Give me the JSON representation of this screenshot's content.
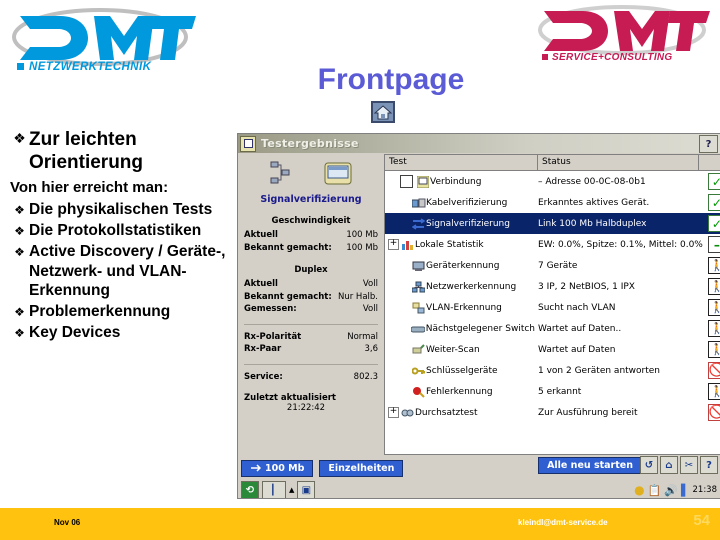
{
  "slide": {
    "title": "Frontpage",
    "home_icon": "home-icon",
    "page_number": "54"
  },
  "logo_left": {
    "word": "DMT",
    "tagline": "NETZWERKTECHNIK",
    "color": "#0099dd"
  },
  "logo_right": {
    "word": "DMT",
    "tagline": "SERVICE+CONSULTING",
    "color": "#c71b54"
  },
  "bullets": [
    {
      "level": 1,
      "mark": "❖",
      "text": "Zur leichten Orientierung"
    }
  ],
  "lead_in": "Von hier erreicht man:",
  "sub_bullets": [
    {
      "mark": "❖",
      "text": "Die physikalischen Tests"
    },
    {
      "mark": "❖",
      "text": "Die Protokollstatistiken"
    },
    {
      "mark": "❖",
      "text": "Active Discovery / Geräte-, Netzwerk- und VLAN-Erkennung"
    },
    {
      "mark": "❖",
      "text": "Problemerkennung"
    },
    {
      "mark": "❖",
      "text": "Key Devices"
    }
  ],
  "app": {
    "title": "Testergebnisse",
    "help_button": "?",
    "left_pane": {
      "heading": "Signalverifizierung",
      "sections": [
        {
          "title": "Geschwindigkeit",
          "rows": [
            {
              "key": "Aktuell",
              "value": "100 Mb"
            },
            {
              "key": "Bekannt gemacht:",
              "value": "100 Mb"
            }
          ]
        },
        {
          "title": "Duplex",
          "rows": [
            {
              "key": "Aktuell",
              "value": "Voll"
            },
            {
              "key": "Bekannt gemacht:",
              "value": "Nur Halb."
            },
            {
              "key": "Gemessen:",
              "value": "Voll"
            }
          ]
        }
      ],
      "extra_rows": [
        {
          "key": "Rx-Polarität",
          "value": "Normal"
        },
        {
          "key": "Rx-Paar",
          "value": "3,6"
        }
      ],
      "service_row": {
        "key": "Service:",
        "value": "802.3"
      },
      "updated_label": "Zuletzt aktualisiert",
      "updated_time": "21:22:42"
    },
    "columns": {
      "test": "Test",
      "status": "Status",
      "icon": ""
    },
    "rows": [
      {
        "indent": 0,
        "expander": "",
        "checkbox": true,
        "icon": "monitor-icon",
        "test": "Verbindung",
        "status": "– Adresse 00-0C-08-0b1",
        "state": "ok",
        "selected": false
      },
      {
        "indent": 1,
        "expander": "",
        "checkbox": false,
        "icon": "cable-icon",
        "test": "Kabelverifizierung",
        "status": "Erkanntes aktives Gerät.",
        "state": "ok",
        "selected": false
      },
      {
        "indent": 1,
        "expander": "",
        "checkbox": false,
        "icon": "signal-icon",
        "test": "Signalverifizierung",
        "status": "Link 100 Mb Halbduplex",
        "state": "ok",
        "selected": true
      },
      {
        "indent": 0,
        "expander": "+",
        "checkbox": false,
        "icon": "chart-icon",
        "test": "Lokale Statistik",
        "status": "EW: 0.0%, Spitze: 0.1%, Mittel: 0.0%",
        "state": "blank",
        "selected": false
      },
      {
        "indent": 1,
        "expander": "",
        "checkbox": false,
        "icon": "device-icon",
        "test": "Geräterkennung",
        "status": "7 Geräte",
        "state": "run",
        "selected": false
      },
      {
        "indent": 1,
        "expander": "",
        "checkbox": false,
        "icon": "network-icon",
        "test": "Netzwerkerkennung",
        "status": "3 IP, 2 NetBIOS, 1 IPX",
        "state": "run",
        "selected": false
      },
      {
        "indent": 1,
        "expander": "",
        "checkbox": false,
        "icon": "vlan-icon",
        "test": "VLAN-Erkennung",
        "status": "Sucht nach VLAN",
        "state": "run",
        "selected": false
      },
      {
        "indent": 1,
        "expander": "",
        "checkbox": false,
        "icon": "switch-icon",
        "test": "Nächstgelegener Switch",
        "status": "Wartet auf Daten..",
        "state": "run",
        "selected": false
      },
      {
        "indent": 1,
        "expander": "",
        "checkbox": false,
        "icon": "scan-icon",
        "test": "Weiter-Scan",
        "status": "Wartet auf Daten",
        "state": "run",
        "selected": false
      },
      {
        "indent": 1,
        "expander": "",
        "checkbox": false,
        "icon": "key-icon",
        "test": "Schlüsselgeräte",
        "status": "1 von 2 Geräten antworten",
        "state": "stop",
        "selected": false
      },
      {
        "indent": 1,
        "expander": "",
        "checkbox": false,
        "icon": "problem-icon",
        "test": "Fehlerkennung",
        "status": "5 erkannt",
        "state": "run",
        "selected": false
      },
      {
        "indent": 0,
        "expander": "+",
        "checkbox": false,
        "icon": "throughput-icon",
        "test": "Durchsatztest",
        "status": "Zur Ausführung bereit",
        "state": "stop",
        "selected": false
      }
    ],
    "buttons": {
      "link_speed": "100 Mb",
      "details": "Einzelheiten",
      "restart_all": "Alle neu starten"
    },
    "tool_icons": [
      "refresh-icon",
      "home-icon",
      "tools-icon",
      "help-icon"
    ],
    "status_icons": [
      "brightness-icon",
      "clipboard-icon",
      "speaker-icon",
      "battery-icon"
    ],
    "clock": "21:38"
  },
  "footer": {
    "date": "Nov 06",
    "email": "kleindl@dmt-service.de"
  }
}
